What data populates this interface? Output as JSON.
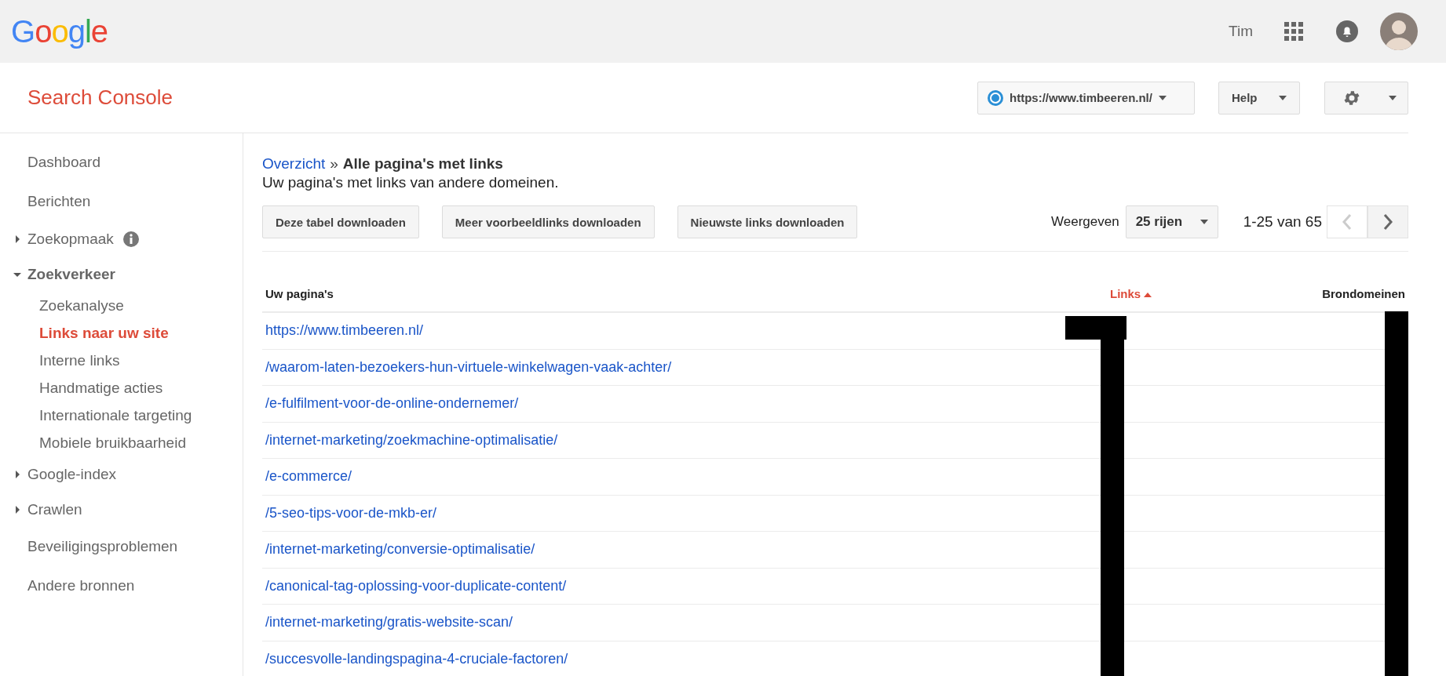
{
  "topbar": {
    "logo": "Google",
    "user": "Tim"
  },
  "header": {
    "title": "Search Console",
    "property": "https://www.timbeeren.nl/",
    "help": "Help"
  },
  "sidebar": {
    "items": [
      {
        "label": "Dashboard",
        "selected": false
      },
      {
        "label": "Berichten",
        "selected": false
      },
      {
        "label": "Zoekopmaak",
        "selected": false,
        "expanded": false,
        "info_icon": true
      },
      {
        "label": "Zoekverkeer",
        "selected": false,
        "expanded": true,
        "children": [
          {
            "label": "Zoekanalyse",
            "selected": false
          },
          {
            "label": "Links naar uw site",
            "selected": true
          },
          {
            "label": "Interne links",
            "selected": false
          },
          {
            "label": "Handmatige acties",
            "selected": false
          },
          {
            "label": "Internationale targeting",
            "selected": false
          },
          {
            "label": "Mobiele bruikbaarheid",
            "selected": false
          }
        ]
      },
      {
        "label": "Google-index",
        "selected": false,
        "expanded": false
      },
      {
        "label": "Crawlen",
        "selected": false,
        "expanded": false
      },
      {
        "label": "Beveiligingsproblemen",
        "selected": false
      },
      {
        "label": "Andere bronnen",
        "selected": false
      }
    ]
  },
  "breadcrumb": {
    "link": "Overzicht",
    "separator": "»",
    "current": "Alle pagina's met links"
  },
  "description": "Uw pagina's met links van andere domeinen.",
  "actions": [
    "Deze tabel downloaden",
    "Meer voorbeeldlinks downloaden",
    "Nieuwste links downloaden"
  ],
  "pagination": {
    "label": "Weergeven",
    "rows": "25 rijen",
    "range": "1-25 van 65"
  },
  "table": {
    "columns": [
      {
        "label": "Uw pagina's",
        "sorted": false
      },
      {
        "label": "Links",
        "sorted": true
      },
      {
        "label": "Brondomeinen",
        "sorted": false
      }
    ],
    "rows": [
      {
        "page": "https://www.timbeeren.nl/"
      },
      {
        "page": "/waarom-laten-bezoekers-hun-virtuele-winkelwagen-vaak-achter/"
      },
      {
        "page": "/e-fulfilment-voor-de-online-ondernemer/"
      },
      {
        "page": "/internet-marketing/zoekmachine-optimalisatie/"
      },
      {
        "page": "/e-commerce/"
      },
      {
        "page": "/5-seo-tips-voor-de-mkb-er/"
      },
      {
        "page": "/internet-marketing/conversie-optimalisatie/"
      },
      {
        "page": "/canonical-tag-oplossing-voor-duplicate-content/"
      },
      {
        "page": "/internet-marketing/gratis-website-scan/"
      },
      {
        "page": "/succesvolle-landingspagina-4-cruciale-factoren/"
      }
    ]
  }
}
